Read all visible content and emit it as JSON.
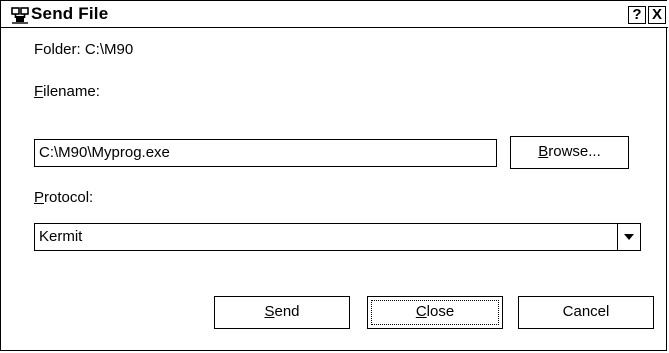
{
  "window": {
    "title": "Send File",
    "help_label": "?",
    "close_label": "X"
  },
  "folder": {
    "text": "Folder:  C:\\M90"
  },
  "filename": {
    "label_accel": "F",
    "label_rest": "ilename:",
    "value": "C:\\M90\\Myprog.exe"
  },
  "browse_button": {
    "accel": "B",
    "rest": "rowse..."
  },
  "protocol": {
    "label_accel": "P",
    "label_rest": "rotocol:",
    "selected": "Kermit"
  },
  "buttons": {
    "send_accel": "S",
    "send_rest": "end",
    "close_accel": "C",
    "close_rest": "lose",
    "cancel": "Cancel"
  },
  "icons": {
    "app": "network-icon",
    "dropdown": "chevron-down-icon"
  }
}
